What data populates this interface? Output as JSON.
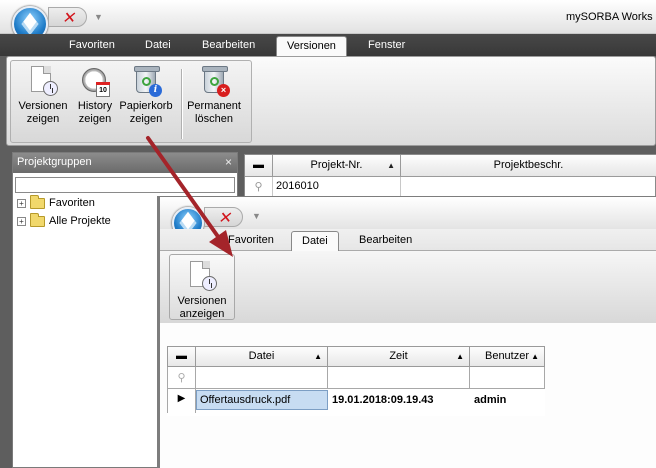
{
  "app": {
    "title": "mySORBA Works"
  },
  "main": {
    "tabs": [
      {
        "label": "Favoriten",
        "active": false
      },
      {
        "label": "Datei",
        "active": false
      },
      {
        "label": "Bearbeiten",
        "active": false
      },
      {
        "label": "Versionen",
        "active": true
      },
      {
        "label": "Fenster",
        "active": false
      }
    ],
    "ribbon": {
      "buttons": [
        {
          "line1": "Versionen",
          "line2": "zeigen",
          "icon": "document-clock-icon"
        },
        {
          "line1": "History",
          "line2": "zeigen",
          "icon": "alarm-clock-calendar-icon"
        },
        {
          "line1": "Papierkorb",
          "line2": "zeigen",
          "icon": "recycle-bin-info-icon"
        },
        {
          "line1": "Permanent",
          "line2": "löschen",
          "icon": "recycle-bin-delete-icon"
        }
      ]
    },
    "left_panel": {
      "title": "Projektgruppen",
      "close": "×",
      "items": [
        {
          "label": "Favoriten",
          "expander": "+"
        },
        {
          "label": "Alle Projekte",
          "expander": "+"
        }
      ]
    },
    "grid": {
      "columns": [
        "Projekt-Nr.",
        "Projektbeschr."
      ],
      "rows": [
        [
          "2016010",
          ""
        ]
      ]
    }
  },
  "window2": {
    "tabs": [
      {
        "label": "Favoriten",
        "active": false
      },
      {
        "label": "Datei",
        "active": true
      },
      {
        "label": "Bearbeiten",
        "active": false
      }
    ],
    "ribbon": {
      "button": {
        "line1": "Versionen",
        "line2": "anzeigen",
        "icon": "document-clock-icon"
      }
    },
    "grid": {
      "columns": [
        "Datei",
        "Zeit",
        "Benutzer"
      ],
      "rows": [
        {
          "datei": "Offertausdruck.pdf",
          "zeit": "19.01.2018:09.19.43",
          "benutzer": "admin"
        }
      ]
    }
  },
  "colors": {
    "accent_arrow": "#a4242a",
    "quick_access_close": "#d2151c",
    "tab_bar": "#3f3f3f"
  }
}
